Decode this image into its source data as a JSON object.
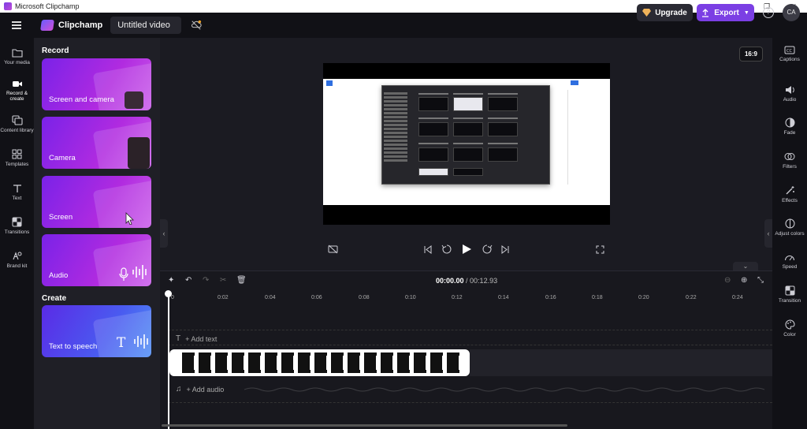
{
  "window": {
    "title": "Microsoft Clipchamp",
    "controls": [
      "—",
      "❐",
      "✕"
    ]
  },
  "header": {
    "brand": "Clipchamp",
    "project_title": "Untitled video",
    "upgrade_label": "Upgrade",
    "export_label": "Export",
    "help_label": "?",
    "avatar_initials": "CA"
  },
  "left_nav": [
    {
      "label": "Your media",
      "icon": "folder-icon"
    },
    {
      "label": "Record & create",
      "icon": "camera-icon"
    },
    {
      "label": "Content library",
      "icon": "library-icon"
    },
    {
      "label": "Templates",
      "icon": "templates-icon"
    },
    {
      "label": "Text",
      "icon": "text-icon"
    },
    {
      "label": "Transitions",
      "icon": "transitions-icon"
    },
    {
      "label": "Brand kit",
      "icon": "brand-kit-icon"
    }
  ],
  "panel": {
    "record_heading": "Record",
    "cards": [
      "Screen and camera",
      "Camera",
      "Screen",
      "Audio"
    ],
    "create_heading": "Create",
    "create_cards": [
      "Text to speech"
    ]
  },
  "stage": {
    "aspect_ratio": "16:9"
  },
  "right_nav": [
    "Captions",
    "Audio",
    "Fade",
    "Filters",
    "Effects",
    "Adjust colors",
    "Speed",
    "Transition",
    "Color"
  ],
  "timeline": {
    "current_time": "00:00.00",
    "total_time": "/ 00:12.93",
    "ticks": [
      "0",
      "0:02",
      "0:04",
      "0:06",
      "0:08",
      "0:10",
      "0:12",
      "0:14",
      "0:16",
      "0:18",
      "0:20",
      "0:22",
      "0:24"
    ],
    "add_text_label": "+ Add text",
    "add_audio_label": "+ Add audio"
  },
  "colors": {
    "accent": "#7b3fe4",
    "background": "#1b1b22",
    "sidebar": "#111116"
  }
}
